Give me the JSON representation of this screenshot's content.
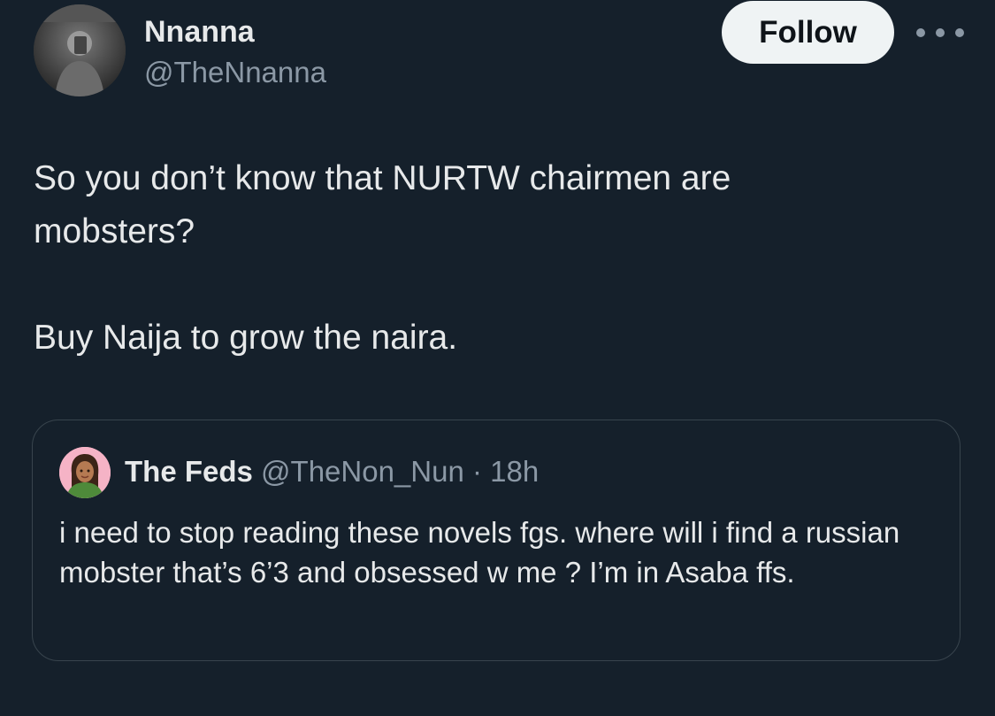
{
  "tweet": {
    "author": {
      "name": "Nnanna",
      "handle": "@TheNnanna"
    },
    "follow_label": "Follow",
    "more_icon": "more-horizontal-icon",
    "text_lines": [
      "So you don’t know that NURTW chairmen are",
      "mobsters?",
      "Buy Naija to grow the naira."
    ]
  },
  "quote": {
    "name": "The Feds",
    "handle": "@TheNon_Nun",
    "separator": "·",
    "time": "18h",
    "text": "i need to stop reading these novels fgs. where will i find a russian mobster that’s 6’3 and obsessed w me ? I’m in Asaba ffs."
  },
  "colors": {
    "background": "#15202b",
    "text_primary": "#e7e9ea",
    "text_secondary": "#8b98a5",
    "border": "#38444d",
    "follow_button_bg": "#eff3f4",
    "follow_button_text": "#0f1419"
  }
}
